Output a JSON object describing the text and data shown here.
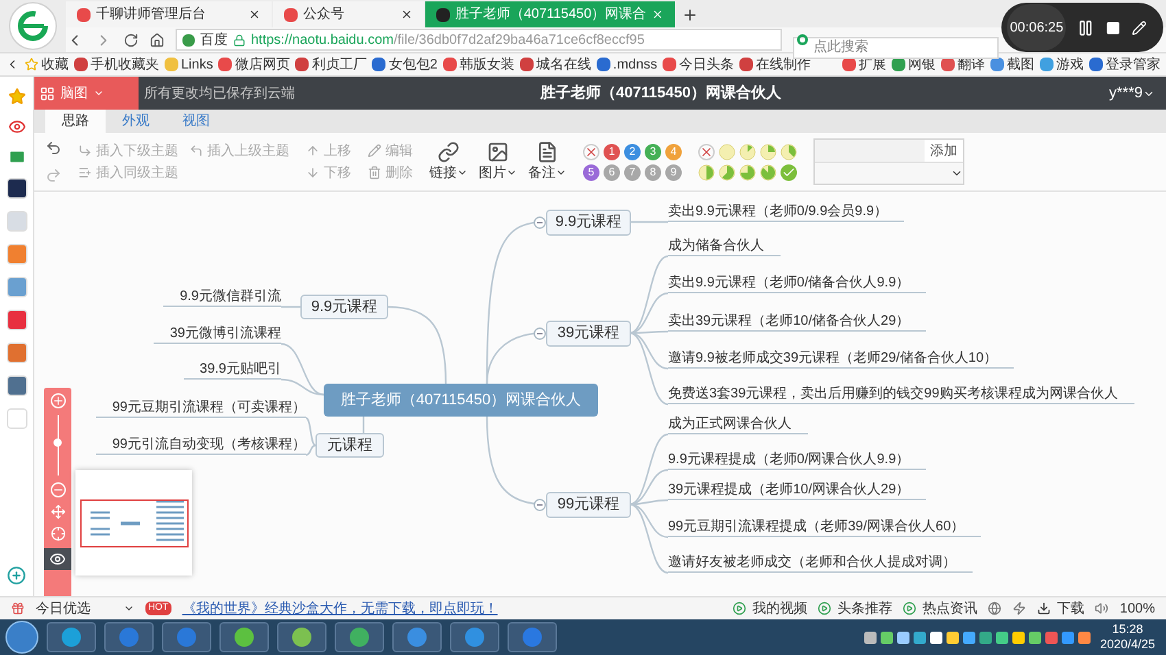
{
  "browser": {
    "tabs": [
      {
        "label": "千聊讲师管理后台",
        "selected": false
      },
      {
        "label": "公众号",
        "selected": false
      },
      {
        "label": "胜子老师（407115450）网课合",
        "selected": true
      }
    ],
    "address": {
      "site": "百度",
      "host": "https://naotu.baidu.com",
      "path": "/file/36db0f7d2af29ba46a71ce6cf8eccf95"
    },
    "search": {
      "placeholder": "点此搜索"
    },
    "bookmarks": [
      "收藏",
      "手机收藏夹",
      "Links",
      "微店网页",
      "利贞工厂",
      "女包包2",
      "韩版女装",
      "城名在线",
      ".mdnss",
      "今日头条",
      "在线制作"
    ],
    "tools": [
      "扩展",
      "网银",
      "翻译",
      "截图",
      "游戏",
      "登录管家"
    ]
  },
  "recorder": {
    "time": "00:06:25"
  },
  "app": {
    "header": {
      "logo": "脑图",
      "save_status": "所有更改均已保存到云端",
      "title": "胜子老师（407115450）网课合伙人",
      "user": "y***9"
    },
    "tabs": [
      {
        "label": "思路",
        "selected": true
      },
      {
        "label": "外观",
        "selected": false
      },
      {
        "label": "视图",
        "selected": false
      }
    ],
    "toolbar": {
      "insert": [
        {
          "kind": "child",
          "label": "插入下级主题",
          "disabled": true
        },
        {
          "kind": "parent",
          "label": "插入上级主题",
          "disabled": true
        },
        {
          "kind": "sibling",
          "label": "插入同级主题",
          "disabled": true
        }
      ],
      "move": [
        {
          "kind": "up",
          "label": "上移",
          "disabled": true
        },
        {
          "kind": "down",
          "label": "下移",
          "disabled": true
        }
      ],
      "edit": [
        {
          "kind": "edit",
          "label": "编辑",
          "disabled": true
        },
        {
          "kind": "delete",
          "label": "删除",
          "disabled": true
        }
      ],
      "media": [
        {
          "kind": "link",
          "label": "链接"
        },
        {
          "kind": "image",
          "label": "图片"
        },
        {
          "kind": "note",
          "label": "备注"
        }
      ],
      "priority": [
        {
          "kind": "clear"
        },
        {
          "kind": "number",
          "label": "1",
          "color": "#e05252"
        },
        {
          "kind": "number",
          "label": "2",
          "color": "#3d8fe0"
        },
        {
          "kind": "number",
          "label": "3",
          "color": "#45b056"
        },
        {
          "kind": "number",
          "label": "4",
          "color": "#f0a23c"
        },
        {
          "kind": "number",
          "label": "5",
          "color": "#9a6ad8"
        },
        {
          "kind": "number",
          "label": "6",
          "color": "#a8a8a8"
        },
        {
          "kind": "number",
          "label": "7",
          "color": "#a8a8a8"
        },
        {
          "kind": "number",
          "label": "8",
          "color": "#a8a8a8"
        },
        {
          "kind": "number",
          "label": "9",
          "color": "#a8a8a8"
        }
      ],
      "progress": [
        {
          "kind": "clear"
        },
        {
          "kind": "empty"
        },
        {
          "kind": "eighth"
        },
        {
          "kind": "quarter"
        },
        {
          "kind": "three_eighths"
        },
        {
          "kind": "half"
        },
        {
          "kind": "five_eighths"
        },
        {
          "kind": "three_quarters"
        },
        {
          "kind": "seven_eighths"
        },
        {
          "kind": "done"
        }
      ],
      "tag": {
        "button": "添加"
      }
    },
    "mindmap": {
      "root": "胜子老师（407115450）网课合伙人",
      "right": [
        {
          "label": "9.9元课程",
          "children": [
            {
              "label": "卖出9.9元课程（老师0/9.9会员9.9）"
            }
          ]
        },
        {
          "label": "39元课程",
          "children": [
            {
              "label": "成为储备合伙人"
            },
            {
              "label": "卖出9.9元课程（老师0/储备合伙人9.9）"
            },
            {
              "label": "卖出39元课程（老师10/储备合伙人29）"
            },
            {
              "label": "邀请9.9被老师成交39元课程（老师29/储备合伙人10）"
            },
            {
              "label": "免费送3套39元课程，卖出后用赚到的钱交99购买考核课程成为网课合伙人"
            }
          ]
        },
        {
          "label": "99元课程",
          "children": [
            {
              "label": "成为正式网课合伙人"
            },
            {
              "label": "9.9元课程提成（老师0/网课合伙人9.9）"
            },
            {
              "label": "39元课程提成（老师10/网课合伙人29）"
            },
            {
              "label": "99元豆期引流课程提成（老师39/网课合伙人60）"
            },
            {
              "label": "邀请好友被老师成交（老师和合伙人提成对调）"
            }
          ]
        }
      ],
      "left": [
        {
          "label": "9.9元课程",
          "children": [
            {
              "label": "9.9元微信群引流"
            }
          ]
        },
        {
          "children": [
            {
              "label": "39元微博引流课程"
            },
            {
              "label": "39.9元贴吧引"
            }
          ]
        },
        {
          "label": "元课程",
          "children": [
            {
              "label": "99元豆期引流课程（可卖课程）"
            },
            {
              "label": "99元引流自动变现（考核课程）"
            }
          ]
        }
      ]
    },
    "zoom": {
      "level": 0.55
    },
    "minimap": {
      "visible": true
    }
  },
  "status_bar": {
    "left": "今日优选",
    "hot": "HOT",
    "ad": "《我的世界》经典沙盒大作，无需下载，即点即玩！",
    "items": [
      "我的视频",
      "头条推荐",
      "热点资讯"
    ],
    "download": "下载",
    "zoom": "100%"
  },
  "taskbar": {
    "time": "15:28",
    "date": "2020/4/25"
  }
}
